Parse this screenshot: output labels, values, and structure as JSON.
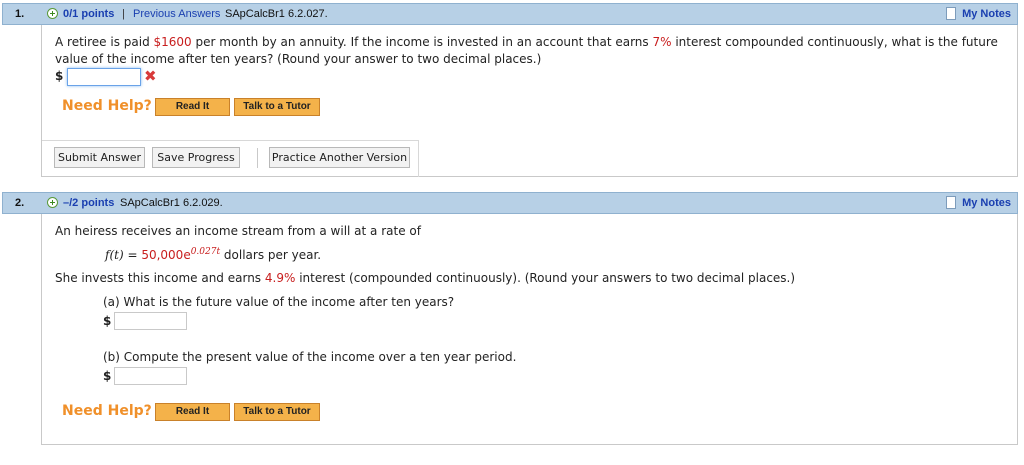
{
  "q1": {
    "number": "1.",
    "points": "0/1 points",
    "separator": "|",
    "previous_answers": "Previous Answers",
    "code": "SApCalcBr1 6.2.027.",
    "my_notes": "My Notes",
    "text_line1_a": "A retiree is paid ",
    "amount": "$1600",
    "text_line1_b": " per month by an annuity. If the income is invested in an account that earns ",
    "rate": "7%",
    "text_line1_c": " interest compounded continuously, what is the future",
    "text_line2": "value of the income after ten years? (Round your answer to two decimal places.)",
    "dollar": "$",
    "answer_value": "",
    "wrong_mark": "✖",
    "need_help": "Need Help?",
    "read_it": "Read It",
    "talk_to_tutor": "Talk to a Tutor",
    "submit": "Submit Answer",
    "save_progress": "Save Progress",
    "practice_another": "Practice Another Version"
  },
  "q2": {
    "number": "2.",
    "points": "–/2 points",
    "code": "SApCalcBr1 6.2.029.",
    "my_notes": "My Notes",
    "intro": "An heiress receives an income stream from a will at a rate of",
    "f_label": "f(t)",
    "equals": " = ",
    "f_value": "50,000e",
    "f_exponent": "0.027t",
    "f_units": "  dollars per year.",
    "invest_a": "She invests this income and earns ",
    "invest_rate": "4.9%",
    "invest_b": " interest (compounded continuously). (Round your answers to two decimal places.)",
    "part_a": "(a) What is the future value of the income after ten years?",
    "part_b": "(b) Compute the present value of the income over a ten year period.",
    "dollar": "$",
    "answer_a": "",
    "answer_b": "",
    "need_help": "Need Help?",
    "read_it": "Read It",
    "talk_to_tutor": "Talk to a Tutor"
  },
  "colors": {
    "header_bg": "#b7d0e6",
    "link_blue": "#1a3fb0",
    "highlight_red": "#c81e1e",
    "help_orange": "#f0902a",
    "help_button": "#f4b24a"
  }
}
